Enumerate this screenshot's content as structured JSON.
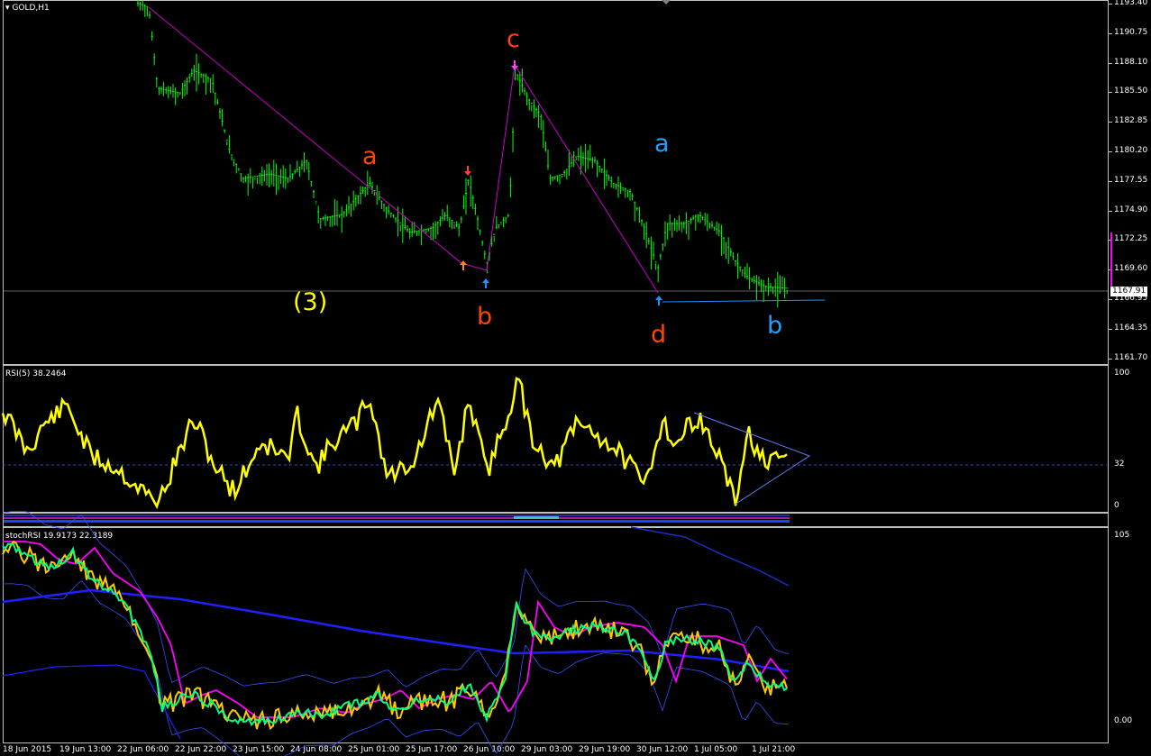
{
  "main": {
    "symbol_label": "GOLD,H1",
    "price_ticks": [
      "1193.40",
      "1190.75",
      "1188.10",
      "1185.50",
      "1182.85",
      "1180.20",
      "1177.55",
      "1174.90",
      "1172.25",
      "1169.60",
      "1166.95",
      "1164.35",
      "1161.70"
    ],
    "current_price": "1167.91",
    "wave_labels": [
      {
        "text": "(3)",
        "color": "#ffff00"
      },
      {
        "text": "a",
        "color": "#ff4500"
      },
      {
        "text": "b",
        "color": "#ff4500"
      },
      {
        "text": "c",
        "color": "#ff4500"
      },
      {
        "text": "d",
        "color": "#ff4500"
      },
      {
        "text": "a",
        "color": "#1ea0ff"
      },
      {
        "text": "b",
        "color": "#1ea0ff"
      }
    ]
  },
  "rsi": {
    "label": "RSI(5) 38.2464",
    "ticks": [
      "100",
      "32",
      "0"
    ]
  },
  "stoch": {
    "label": "stochRSI 19.9173 22.3189",
    "ticks": [
      "105",
      "0.00"
    ]
  },
  "time_ticks": [
    "18 Jun 2015",
    "19 Jun 13:00",
    "22 Jun 06:00",
    "22 Jun 22:00",
    "23 Jun 15:00",
    "24 Jun 08:00",
    "25 Jun 01:00",
    "25 Jun 17:00",
    "26 Jun 10:00",
    "29 Jun 03:00",
    "29 Jun 19:00",
    "30 Jun 12:00",
    "1 Jul 05:00",
    "1 Jul 21:00"
  ],
  "colors": {
    "candles": "#00ff00",
    "wave_line": "#c800c8",
    "rsi_line": "#ffff00",
    "k_line": "#ffc800",
    "d_line": "#00ff80",
    "ma_line": "#ff00ff",
    "slow_ma": "#2020ff",
    "band": "#3050ff"
  }
}
